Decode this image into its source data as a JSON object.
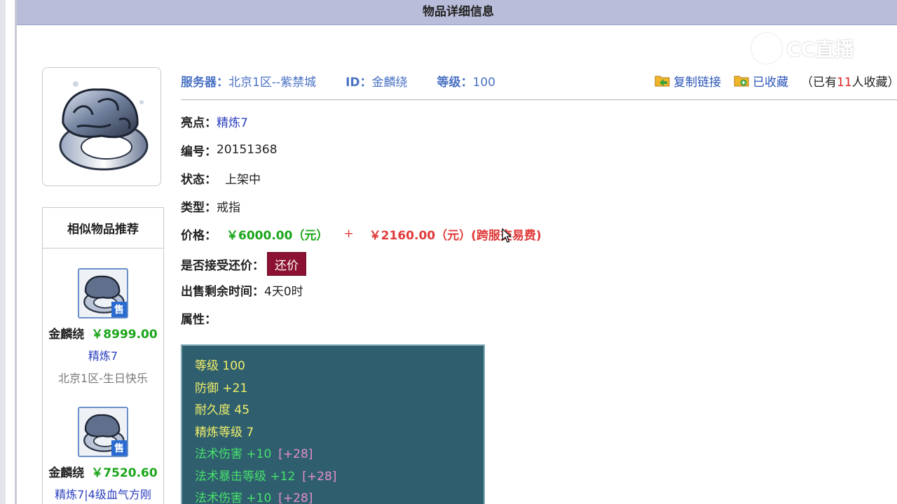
{
  "header": {
    "title": "物品详细信息"
  },
  "watermark": {
    "text": "CC直播"
  },
  "item": {
    "image_icon": "ring-icon",
    "server_label": "服务器：",
    "server_value": "北京1区--紫禁城",
    "id_label": "ID：",
    "id_value": "金麟绕",
    "level_label": "等级：",
    "level_value": "100",
    "copy_link_label": "复制链接",
    "favorited_label": "已收藏",
    "favorite_count_prefix": "（已有",
    "favorite_count": "11",
    "favorite_count_suffix": "人收藏）"
  },
  "details": {
    "highlight_label": "亮点：",
    "highlight_value": "精炼7",
    "number_label": "编号：",
    "number_value": "20151368",
    "status_label": "状态：",
    "status_value": "上架中",
    "type_label": "类型：",
    "type_value": "戒指",
    "price_label": "价格：",
    "price_main": "￥6000.00（元）",
    "price_plus": "+",
    "price_fee": "￥2160.00（元）(跨服交易费)",
    "counter_label": "是否接受还价：",
    "counter_button": "还价",
    "remaining_label": "出售剩余时间：",
    "remaining_value": "4天0时",
    "attributes_label": "属性："
  },
  "attributes": [
    {
      "text": "等级 100",
      "bonus": ""
    },
    {
      "text": "防御 +21",
      "bonus": ""
    },
    {
      "text": "耐久度 45",
      "bonus": ""
    },
    {
      "text": "精炼等级 7",
      "bonus": ""
    },
    {
      "text": "法术伤害 +10",
      "bonus": "[+28]"
    },
    {
      "text": "法术暴击等级 +12",
      "bonus": "[+28]"
    },
    {
      "text": "法术伤害 +10",
      "bonus": "[+28]"
    }
  ],
  "similar": {
    "title": "相似物品推荐",
    "sold_badge": "售",
    "items": [
      {
        "name": "金麟绕",
        "price": "￥8999.00",
        "tag": "精炼7",
        "server": "北京1区-生日快乐"
      },
      {
        "name": "金麟绕",
        "price": "￥7520.60",
        "tag": "精炼7|4级血气方刚",
        "server": ""
      }
    ]
  },
  "colors": {
    "header_bg": "#b9bdd9",
    "price_green": "#1aa51a",
    "price_red": "#e03a3a",
    "counter_button_bg": "#8b1232",
    "attr_box_bg": "#2f5f6e"
  }
}
